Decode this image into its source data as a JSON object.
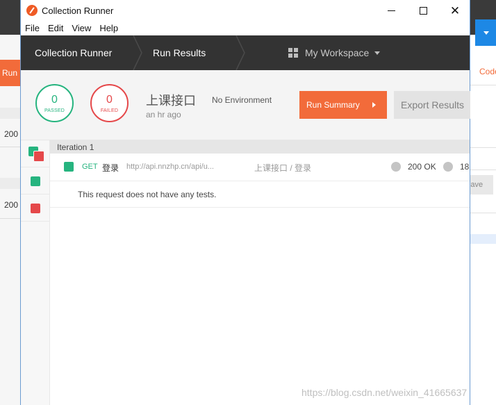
{
  "window": {
    "title": "Collection Runner",
    "controls": {
      "minimize": "—",
      "maximize": "☐",
      "close": "✕"
    }
  },
  "menu": [
    "File",
    "Edit",
    "View",
    "Help"
  ],
  "nav": {
    "crumbs": [
      "Collection Runner",
      "Run Results"
    ],
    "workspace": "My Workspace"
  },
  "summary": {
    "passed_count": "0",
    "passed_label": "PASSED",
    "failed_count": "0",
    "failed_label": "FAILED",
    "collection_name": "上课接口",
    "environment": "No Environment",
    "run_time": "an hr ago",
    "run_summary_label": "Run Summary",
    "export_label": "Export Results"
  },
  "iterations": [
    {
      "label": "Iteration 1",
      "requests": [
        {
          "method": "GET",
          "name": "登录",
          "url": "http://api.nnzhp.cn/api/u...",
          "path": "上课接口 / 登录",
          "status": "200 OK",
          "time": "18",
          "tests_message": "This request does not have any tests."
        }
      ]
    }
  ],
  "background": {
    "run_label": "Run",
    "code_link": "Code",
    "save_label": "Save",
    "status_code_1": "200",
    "status_code_2": "200"
  },
  "watermark": "https://blog.csdn.net/weixin_41665637",
  "colors": {
    "pass": "#26b47f",
    "fail": "#e5484a",
    "accent": "#f26b3a",
    "nav_bg": "#333333"
  }
}
